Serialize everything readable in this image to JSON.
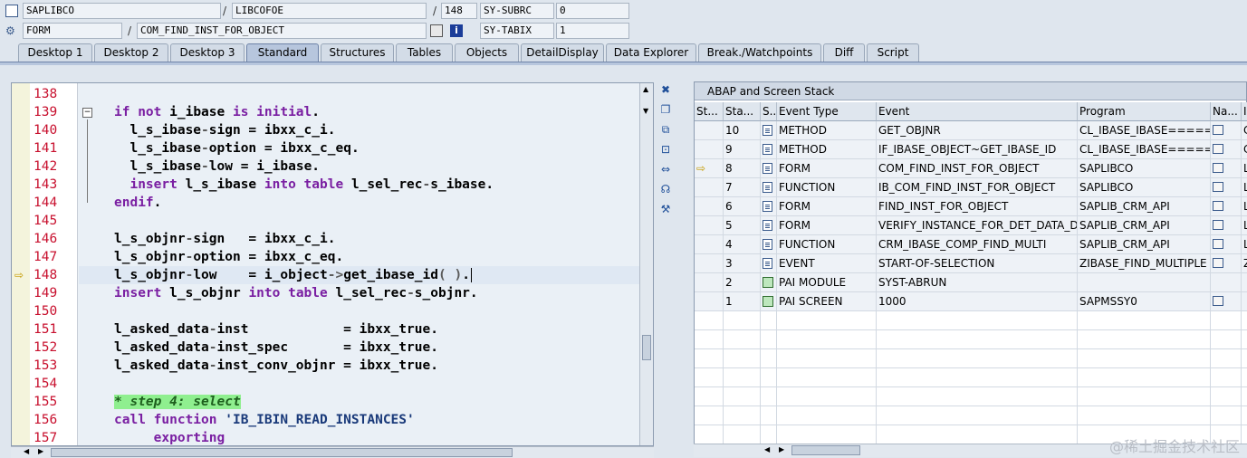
{
  "header": {
    "row1": {
      "program": "SAPLIBCO",
      "include": "LIBCOFOE",
      "line": "148",
      "var_name": "SY-SUBRC",
      "var_value": "0"
    },
    "row2": {
      "type": "FORM",
      "name": "COM_FIND_INST_FOR_OBJECT",
      "var_name": "SY-TABIX",
      "var_value": "1"
    },
    "separator": "/"
  },
  "tabs": [
    "Desktop 1",
    "Desktop 2",
    "Desktop 3",
    "Standard",
    "Structures",
    "Tables",
    "Objects",
    "DetailDisplay",
    "Data Explorer",
    "Break./Watchpoints",
    "Diff",
    "Script"
  ],
  "active_tab": "Standard",
  "editor": {
    "lines": [
      {
        "n": "138",
        "html": ""
      },
      {
        "n": "139",
        "html": "<span class='kw'>if not</span> <span class='id'>i_ibase</span> <span class='kw'>is initial</span>."
      },
      {
        "n": "140",
        "html": "  <span class='id'>l_s_ibase</span><span class='op'>-</span><span class='id'>sign</span> = <span class='id'>ibxx_c_i</span>."
      },
      {
        "n": "141",
        "html": "  <span class='id'>l_s_ibase</span><span class='op'>-</span><span class='id'>option</span> = <span class='id'>ibxx_c_eq</span>."
      },
      {
        "n": "142",
        "html": "  <span class='id'>l_s_ibase</span><span class='op'>-</span><span class='id'>low</span> = <span class='id'>i_ibase</span>."
      },
      {
        "n": "143",
        "html": "  <span class='kw'>insert</span> <span class='id'>l_s_ibase</span> <span class='kw'>into table</span> <span class='id'>l_sel_rec</span><span class='op'>-</span><span class='id'>s_ibase</span>."
      },
      {
        "n": "144",
        "html": "<span class='kw'>endif</span>."
      },
      {
        "n": "145",
        "html": ""
      },
      {
        "n": "146",
        "html": "<span class='id'>l_s_objnr</span><span class='op'>-</span><span class='id'>sign</span>   = <span class='id'>ibxx_c_i</span>."
      },
      {
        "n": "147",
        "html": "<span class='id'>l_s_objnr</span><span class='op'>-</span><span class='id'>option</span> = <span class='id'>ibxx_c_eq</span>."
      },
      {
        "n": "148",
        "html": "<span class='id'>l_s_objnr</span><span class='op'>-</span><span class='id'>low</span>    = <span class='id'>i_object</span><span class='op'>-&gt;</span><span class='id'>get_ibase_id</span><span class='op'>( )</span>."
      },
      {
        "n": "149",
        "html": "<span class='kw'>insert</span> <span class='id'>l_s_objnr</span> <span class='kw'>into table</span> <span class='id'>l_sel_rec</span><span class='op'>-</span><span class='id'>s_objnr</span>."
      },
      {
        "n": "150",
        "html": ""
      },
      {
        "n": "151",
        "html": "<span class='id'>l_asked_data</span><span class='op'>-</span><span class='id'>inst</span>            = <span class='id'>ibxx_true</span>."
      },
      {
        "n": "152",
        "html": "<span class='id'>l_asked_data</span><span class='op'>-</span><span class='id'>inst_spec</span>       = <span class='id'>ibxx_true</span>."
      },
      {
        "n": "153",
        "html": "<span class='id'>l_asked_data</span><span class='op'>-</span><span class='id'>inst_conv_objnr</span> = <span class='id'>ibxx_true</span>."
      },
      {
        "n": "154",
        "html": ""
      },
      {
        "n": "155",
        "html": "<span class='cmt'>* step 4: select</span>"
      },
      {
        "n": "156",
        "html": "<span class='kw'>call function</span> <span class='str'>'IB_IBIN_READ_INSTANCES'</span>"
      },
      {
        "n": "157",
        "html": "     <span class='kw'>exporting</span>"
      }
    ]
  },
  "stack": {
    "title": "ABAP and Screen Stack",
    "columns": [
      "St...",
      "Sta...",
      "S...",
      "Event Type",
      "Event",
      "Program",
      "Na...",
      "In"
    ],
    "rows": [
      {
        "level": "10",
        "kind": "doc",
        "type": "METHOD",
        "event": "GET_OBJNR",
        "program": "CL_IBASE_IBASE=====...",
        "nav": true,
        "inc": "Cl"
      },
      {
        "level": "9",
        "kind": "doc",
        "type": "METHOD",
        "event": "IF_IBASE_OBJECT~GET_IBASE_ID",
        "program": "CL_IBASE_IBASE=====...",
        "nav": true,
        "inc": "Cl"
      },
      {
        "level": "8",
        "kind": "doc",
        "type": "FORM",
        "event": "COM_FIND_INST_FOR_OBJECT",
        "program": "SAPLIBCO",
        "nav": true,
        "inc": "LI",
        "current": true
      },
      {
        "level": "7",
        "kind": "doc",
        "type": "FUNCTION",
        "event": "IB_COM_FIND_INST_FOR_OBJECT",
        "program": "SAPLIBCO",
        "nav": true,
        "inc": "LI"
      },
      {
        "level": "6",
        "kind": "doc",
        "type": "FORM",
        "event": "FIND_INST_FOR_OBJECT",
        "program": "SAPLIB_CRM_API",
        "nav": true,
        "inc": "LI"
      },
      {
        "level": "5",
        "kind": "doc",
        "type": "FORM",
        "event": "VERIFY_INSTANCE_FOR_DET_DATA_D",
        "program": "SAPLIB_CRM_API",
        "nav": true,
        "inc": "LI"
      },
      {
        "level": "4",
        "kind": "doc",
        "type": "FUNCTION",
        "event": "CRM_IBASE_COMP_FIND_MULTI",
        "program": "SAPLIB_CRM_API",
        "nav": true,
        "inc": "LI"
      },
      {
        "level": "3",
        "kind": "doc",
        "type": "EVENT",
        "event": "START-OF-SELECTION",
        "program": "ZIBASE_FIND_MULTIPLE",
        "nav": true,
        "inc": "Zl"
      },
      {
        "level": "2",
        "kind": "img",
        "type": "PAI MODULE",
        "event": "SYST-ABRUN",
        "program": "",
        "nav": false,
        "inc": ""
      },
      {
        "level": "1",
        "kind": "img",
        "type": "PAI SCREEN",
        "event": "1000",
        "program": "SAPMSSY0",
        "nav": true,
        "inc": ""
      }
    ]
  },
  "watermark": "@稀土掘金技术社区"
}
